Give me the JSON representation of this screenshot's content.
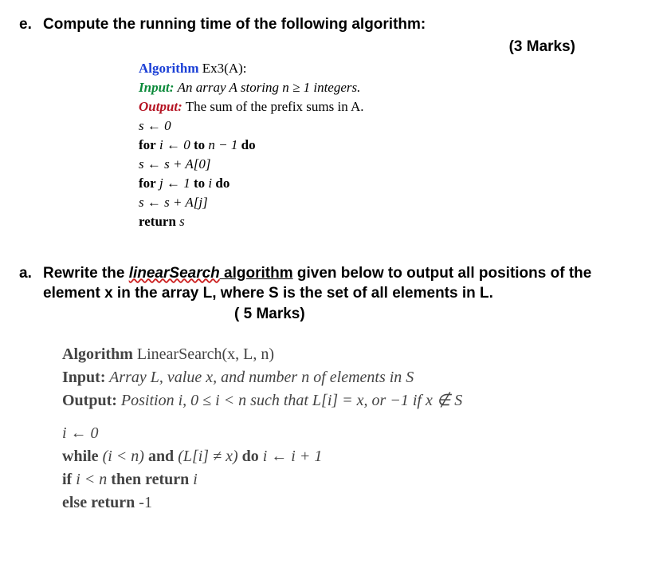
{
  "q_e": {
    "label": "e.",
    "text": "Compute the running time of the following algorithm:",
    "marks": "(3 Marks)",
    "algo": {
      "title_kw": "Algorithm",
      "title_name": "Ex3(A):",
      "input_kw": "Input:",
      "input_text": "An array A storing n ≥ 1 integers.",
      "output_kw": "Output:",
      "output_text": "The sum of the prefix sums in A.",
      "l1": "s ← 0",
      "l2a": "for",
      "l2b": " i ← 0 ",
      "l2c": "to",
      "l2d": " n − 1 ",
      "l2e": "do",
      "l3": "s ← s + A[0]",
      "l4a": "for",
      "l4b": " j ← 1 ",
      "l4c": "to",
      "l4d": " i ",
      "l4e": "do",
      "l5": "s ← s + A[j]",
      "l6a": "return",
      "l6b": " s"
    }
  },
  "q_a": {
    "label": "a.",
    "text1": "Rewrite the ",
    "wavy": "linearSearch",
    "text1b": " algorithm",
    "text2": " given below to output all positions of the element x in the array L, where S is the set of all elements in L.",
    "marks": "( 5 Marks)",
    "algo": {
      "title_kw": "Algorithm",
      "title_name": " LinearSearch(x, L, n)",
      "input_kw": "Input:",
      "input_text": " Array L, value x, and number n of elements in S",
      "output_kw": "Output:",
      "output_text": " Position i, 0 ≤ i < n such that L[i] = x, or −1 if x ∉ S",
      "l1": "i ← 0",
      "l2a": "while",
      "l2b": " (i < n) ",
      "l2c": "and",
      "l2d": " (L[i] ≠ x) ",
      "l2e": "do",
      "l2f": " i ← i + 1",
      "l3a": "if",
      "l3b": " i < n ",
      "l3c": "then return",
      "l3d": " i",
      "l4a": "else return",
      "l4b": " -1"
    }
  }
}
